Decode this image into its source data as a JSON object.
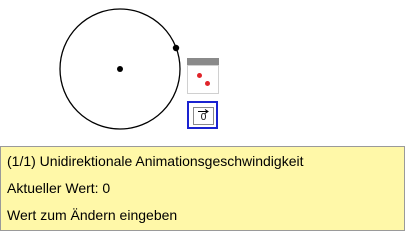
{
  "tooltip": {
    "title": "(1/1) Unidirektionale Animationsgeschwindigkeit",
    "current_value": "Aktueller Wert: 0",
    "hint": "Wert zum Ändern eingeben"
  },
  "speed_control": {
    "value": "0",
    "icon": "right-arrow-icon"
  },
  "random_tool": {
    "icon": "dice-icon"
  },
  "colors": {
    "tooltip_bg": "#fff8a8",
    "selection_border": "#1a23d0",
    "dice_pip": "#e0242a"
  }
}
